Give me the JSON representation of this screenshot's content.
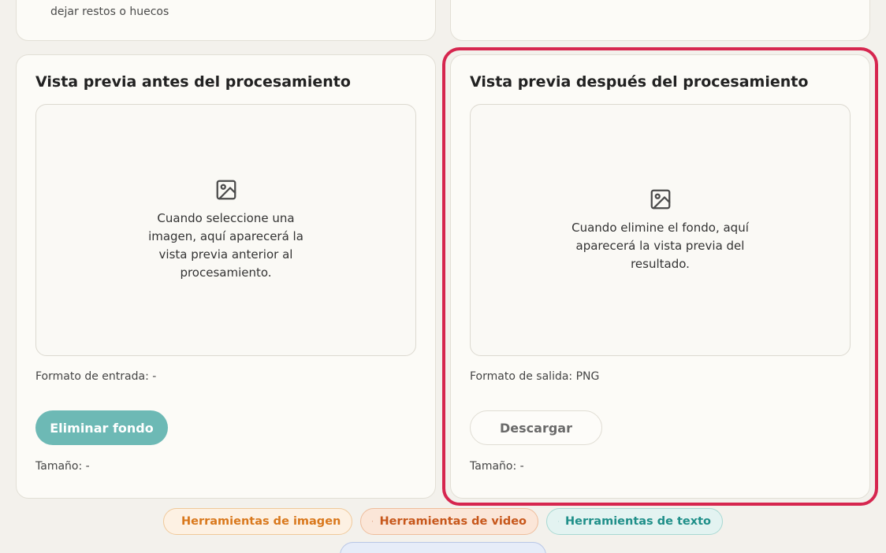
{
  "top_card": {
    "snippet": "dejar restos o huecos"
  },
  "before_panel": {
    "title": "Vista previa antes del procesamiento",
    "icon": "image-icon",
    "placeholder": "Cuando seleccione una imagen, aquí aparecerá la vista previa anterior al procesamiento.",
    "format_label": "Formato de entrada: -",
    "button_label": "Eliminar fondo",
    "size_label": "Tamaño: -"
  },
  "after_panel": {
    "title": "Vista previa después del procesamiento",
    "icon": "image-icon",
    "placeholder": "Cuando elimine el fondo, aquí aparecerá la vista previa del resultado.",
    "format_label": "Formato de salida: PNG",
    "button_label": "Descargar",
    "size_label": "Tamaño: -"
  },
  "tool_chips": [
    {
      "label": "Herramientas de imagen",
      "icon": "image-icon",
      "color": "#d9781c"
    },
    {
      "label": "Herramientas de video",
      "icon": "clapperboard-icon",
      "color": "#c7571b"
    },
    {
      "label": "Herramientas de texto",
      "icon": "text-icon",
      "color": "#1f8f89"
    }
  ],
  "colors": {
    "accent_teal": "#6db9b5",
    "highlight": "#d6264f",
    "background": "#f3f1ec",
    "card": "#fcfbf7"
  }
}
